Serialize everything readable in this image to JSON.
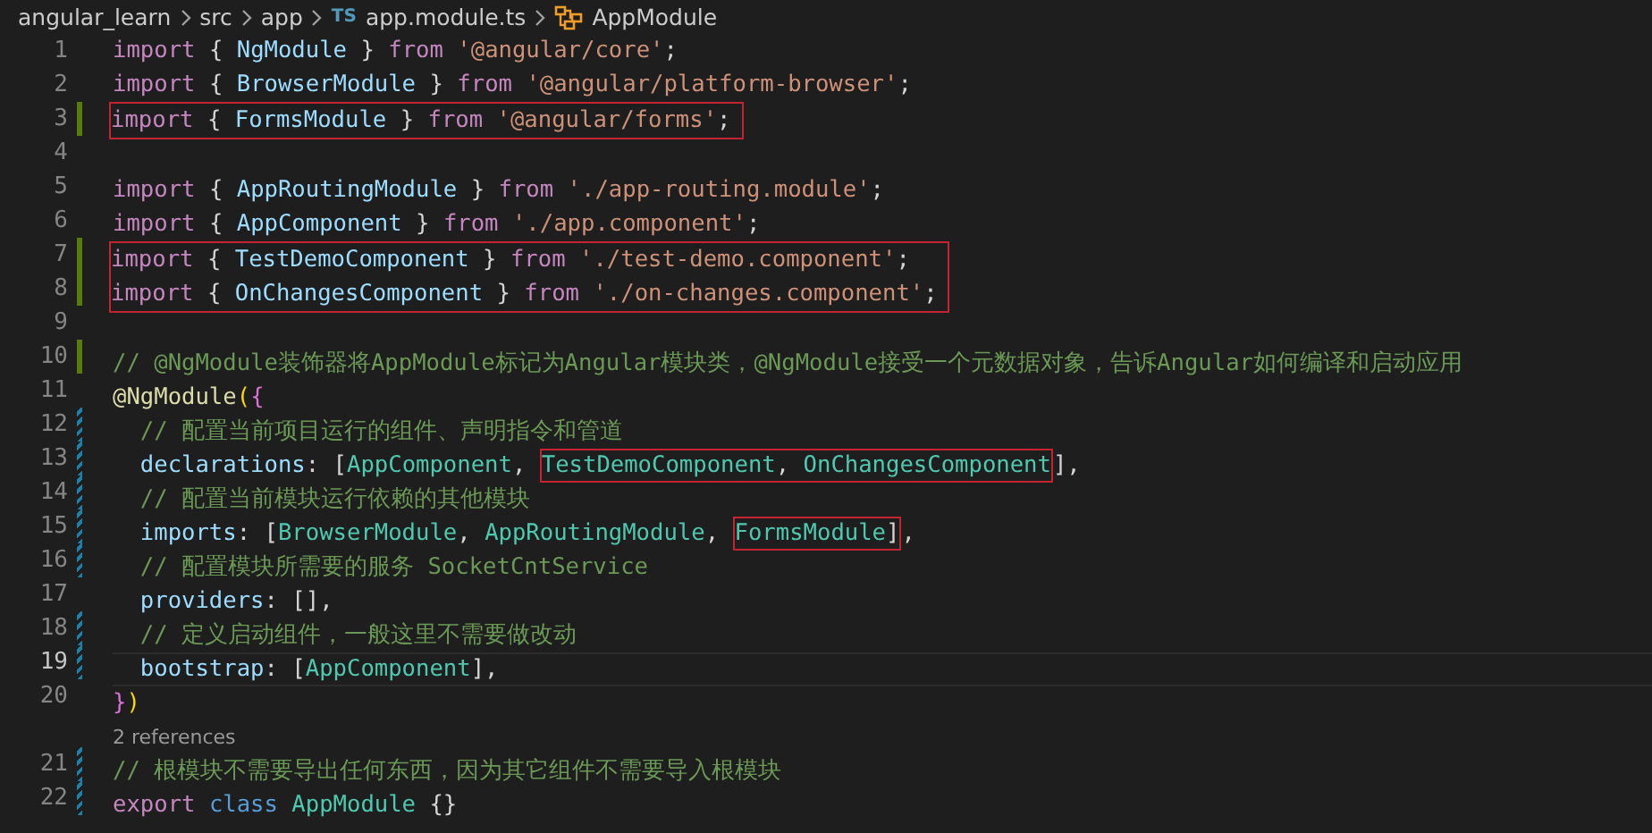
{
  "breadcrumb": [
    {
      "label": "angular_learn",
      "kind": "folder"
    },
    {
      "label": "src",
      "kind": "folder"
    },
    {
      "label": "app",
      "kind": "folder"
    },
    {
      "label": "app.module.ts",
      "kind": "file",
      "badge": "TS"
    },
    {
      "label": "AppModule",
      "kind": "symbol"
    }
  ],
  "lines": [
    {
      "number": "1",
      "added": false,
      "modified": false,
      "boxed": false,
      "current": false,
      "tokens": [
        {
          "kind": "keyword",
          "text": "import"
        },
        {
          "kind": "punct",
          "text": " { "
        },
        {
          "kind": "variable",
          "text": "NgModule"
        },
        {
          "kind": "punct",
          "text": " } "
        },
        {
          "kind": "keyword",
          "text": "from "
        },
        {
          "kind": "string",
          "text": "'@angular/core'"
        },
        {
          "kind": "punct",
          "text": ";"
        }
      ]
    },
    {
      "number": "2",
      "added": false,
      "modified": false,
      "boxed": false,
      "current": false,
      "tokens": [
        {
          "kind": "keyword",
          "text": "import"
        },
        {
          "kind": "punct",
          "text": " { "
        },
        {
          "kind": "variable",
          "text": "BrowserModule"
        },
        {
          "kind": "punct",
          "text": " } "
        },
        {
          "kind": "keyword",
          "text": "from "
        },
        {
          "kind": "string",
          "text": "'@angular/platform-browser'"
        },
        {
          "kind": "punct",
          "text": ";"
        }
      ]
    },
    {
      "number": "3",
      "added": true,
      "modified": false,
      "boxed": true,
      "current": false,
      "tokens": [
        {
          "kind": "keyword",
          "text": "import"
        },
        {
          "kind": "punct",
          "text": " { "
        },
        {
          "kind": "variable",
          "text": "FormsModule"
        },
        {
          "kind": "punct",
          "text": " } "
        },
        {
          "kind": "keyword",
          "text": "from "
        },
        {
          "kind": "string",
          "text": "'@angular/forms'"
        },
        {
          "kind": "punct",
          "text": ";"
        }
      ]
    },
    {
      "number": "4",
      "added": false,
      "modified": false,
      "boxed": false,
      "current": false
    },
    {
      "number": "5",
      "added": false,
      "modified": false,
      "boxed": false,
      "current": false,
      "tokens": [
        {
          "kind": "keyword",
          "text": "import"
        },
        {
          "kind": "punct",
          "text": " { "
        },
        {
          "kind": "variable",
          "text": "AppRoutingModule"
        },
        {
          "kind": "punct",
          "text": " } "
        },
        {
          "kind": "keyword",
          "text": "from "
        },
        {
          "kind": "string",
          "text": "'./app-routing.module'"
        },
        {
          "kind": "punct",
          "text": ";"
        }
      ]
    },
    {
      "number": "6",
      "added": false,
      "modified": false,
      "boxed": false,
      "current": false,
      "tokens": [
        {
          "kind": "keyword",
          "text": "import"
        },
        {
          "kind": "punct",
          "text": " { "
        },
        {
          "kind": "variable",
          "text": "AppComponent"
        },
        {
          "kind": "punct",
          "text": " } "
        },
        {
          "kind": "keyword",
          "text": "from "
        },
        {
          "kind": "string",
          "text": "'./app.component'"
        },
        {
          "kind": "punct",
          "text": ";"
        }
      ]
    },
    {
      "number": "7",
      "added": true,
      "modified": false,
      "boxed": true,
      "current": false,
      "tokens": [
        {
          "kind": "keyword",
          "text": "import"
        },
        {
          "kind": "punct",
          "text": " { "
        },
        {
          "kind": "variable",
          "text": "TestDemoComponent"
        },
        {
          "kind": "punct",
          "text": " } "
        },
        {
          "kind": "keyword",
          "text": "from "
        },
        {
          "kind": "string",
          "text": "'./test-demo.component'"
        },
        {
          "kind": "punct",
          "text": ";"
        }
      ]
    },
    {
      "number": "8",
      "added": true,
      "modified": false,
      "boxed": true,
      "current": false,
      "tokens": [
        {
          "kind": "keyword",
          "text": "import"
        },
        {
          "kind": "punct",
          "text": " { "
        },
        {
          "kind": "variable",
          "text": "OnChangesComponent"
        },
        {
          "kind": "punct",
          "text": " } "
        },
        {
          "kind": "keyword",
          "text": "from "
        },
        {
          "kind": "string",
          "text": "'./on-changes.component'"
        },
        {
          "kind": "punct",
          "text": ";"
        }
      ]
    },
    {
      "number": "9",
      "added": false,
      "modified": false,
      "boxed": false,
      "current": false
    },
    {
      "number": "10",
      "added": true,
      "modified": false,
      "boxed": false,
      "current": false,
      "tokens": [
        {
          "kind": "comment",
          "text": "// @NgModule装饰器将AppModule标记为Angular模块类，@NgModule接受一个元数据对象，告诉Angular如何编译和启动应用"
        }
      ]
    },
    {
      "number": "11",
      "added": false,
      "modified": false,
      "boxed": false,
      "current": false,
      "tokens": [
        {
          "kind": "decorator",
          "text": "@NgModule"
        },
        {
          "kind": "paren",
          "text": "("
        },
        {
          "kind": "brace",
          "text": "{"
        }
      ]
    },
    {
      "number": "12",
      "added": false,
      "modified": true,
      "boxed": false,
      "current": false,
      "tokens": [
        {
          "kind": "comment",
          "text": "  // 配置当前项目运行的组件、声明指令和管道"
        }
      ]
    },
    {
      "number": "13",
      "added": false,
      "modified": true,
      "boxed": false,
      "current": false,
      "tokens": [
        {
          "kind": "property",
          "text": "  declarations"
        },
        {
          "kind": "punct",
          "text": ": ["
        },
        {
          "kind": "type",
          "text": "AppComponent"
        },
        {
          "kind": "punct",
          "text": ", "
        },
        {
          "kind": "type",
          "text": "TestDemoComponent",
          "boxed": true
        },
        {
          "kind": "punct",
          "text": ", ",
          "boxed": true
        },
        {
          "kind": "type",
          "text": "OnChangesComponent",
          "boxed": true
        },
        {
          "kind": "punct",
          "text": "],"
        }
      ]
    },
    {
      "number": "14",
      "added": false,
      "modified": true,
      "boxed": false,
      "current": false,
      "tokens": [
        {
          "kind": "comment",
          "text": "  // 配置当前模块运行依赖的其他模块"
        }
      ]
    },
    {
      "number": "15",
      "added": false,
      "modified": true,
      "boxed": false,
      "current": false,
      "tokens": [
        {
          "kind": "property",
          "text": "  imports"
        },
        {
          "kind": "punct",
          "text": ": ["
        },
        {
          "kind": "type",
          "text": "BrowserModule"
        },
        {
          "kind": "punct",
          "text": ", "
        },
        {
          "kind": "type",
          "text": "AppRoutingModule"
        },
        {
          "kind": "punct",
          "text": ", "
        },
        {
          "kind": "type",
          "text": "FormsModule",
          "boxed": true
        },
        {
          "kind": "punct",
          "text": "]",
          "boxed": true
        },
        {
          "kind": "punct",
          "text": ","
        }
      ]
    },
    {
      "number": "16",
      "added": false,
      "modified": true,
      "boxed": false,
      "current": false,
      "tokens": [
        {
          "kind": "comment",
          "text": "  // 配置模块所需要的服务 SocketCntService"
        }
      ]
    },
    {
      "number": "17",
      "added": false,
      "modified": false,
      "boxed": false,
      "current": false,
      "tokens": [
        {
          "kind": "property",
          "text": "  providers"
        },
        {
          "kind": "punct",
          "text": ": [],"
        }
      ]
    },
    {
      "number": "18",
      "added": false,
      "modified": true,
      "boxed": false,
      "current": false,
      "tokens": [
        {
          "kind": "comment",
          "text": "  // 定义启动组件，一般这里不需要做改动"
        }
      ]
    },
    {
      "number": "19",
      "added": false,
      "modified": true,
      "boxed": false,
      "current": true,
      "tokens": [
        {
          "kind": "property",
          "text": "  bootstrap"
        },
        {
          "kind": "punct",
          "text": ": ["
        },
        {
          "kind": "type",
          "text": "AppComponent"
        },
        {
          "kind": "punct",
          "text": "],"
        }
      ]
    },
    {
      "number": "20",
      "added": false,
      "modified": false,
      "boxed": false,
      "current": false,
      "tokens": [
        {
          "kind": "brace",
          "text": "}"
        },
        {
          "kind": "paren",
          "text": ")"
        }
      ]
    },
    {
      "number": "21",
      "added": false,
      "modified": true,
      "boxed": false,
      "current": false,
      "codelens": "2 references",
      "tokens": [
        {
          "kind": "comment",
          "text": "// 根模块不需要导出任何东西，因为其它组件不需要导入根模块"
        }
      ]
    },
    {
      "number": "22",
      "added": false,
      "modified": true,
      "boxed": false,
      "current": false,
      "tokens": [
        {
          "kind": "keyword",
          "text": "export "
        },
        {
          "kind": "class",
          "text": "class "
        },
        {
          "kind": "type",
          "text": "AppModule"
        },
        {
          "kind": "punct",
          "text": " {}"
        }
      ]
    }
  ]
}
